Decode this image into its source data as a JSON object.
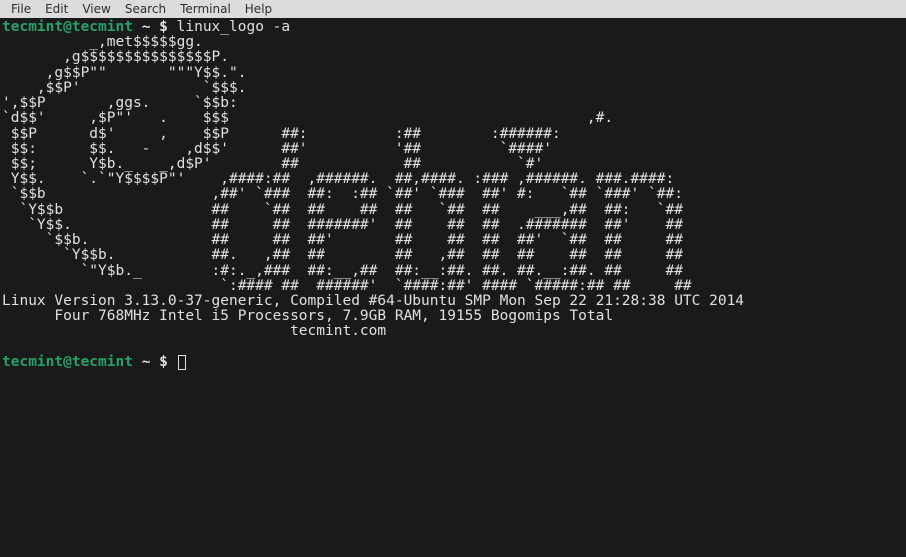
{
  "menubar": {
    "items": [
      "File",
      "Edit",
      "View",
      "Search",
      "Terminal",
      "Help"
    ]
  },
  "prompt1": {
    "user_host": "tecmint@tecmint",
    "sep": " ",
    "path": "~",
    "dollar": " $ ",
    "command": "linux_logo -a"
  },
  "ascii_art": "          _,met$$$$$gg.\n       ,g$$$$$$$$$$$$$$$P.\n     ,g$$P\"\"       \"\"\"Y$$.\".\n    ,$$P'              `$$$.\n',$$P       ,ggs.     `$$b:\n`d$$'     ,$P\"'   .    $$$                                         ,#.\n $$P      d$'     ,    $$P      ##:          :##        :######:\n $$:      $$.   -    ,d$$'      ##'          '##         `####'\n $$;      Y$b._   _,d$P'        ##            ##           `#'\n Y$$.    `.`\"Y$$$$P\"'    ,####:##  ,######.  ##,####. :### ,######. ###.####:\n `$$b                   ,##' `###  ##:  :## `##' `###  ##' #:   `## `###' `##:\n  `Y$$b                 ##    `##  ##    ##  ##   `##  ##    ___,##  ##:   `##\n   `Y$$.                ##     ##  #######'  ##    ##  ##  .#######  ##'    ##\n     `$$b.              ##     ##  ##'       ##    ##  ##  ##'  `##  ##     ##\n       `Y$$b.           ##.   ,##  ##        ##   ,##  ##  ##    ##  ##     ##\n         `\"Y$b._        :#:._,###  ##:__,##  ##:__:##. ##. ##.__:##. ##     ##\n                         `:#### ##  ######'  `####:##' #### `#####:## ##     ##\n",
  "sysinfo": {
    "line1": "Linux Version 3.13.0-37-generic, Compiled #64-Ubuntu SMP Mon Sep 22 21:28:38 UTC 2014",
    "line2": "      Four 768MHz Intel i5 Processors, 7.9GB RAM, 19155 Bogomips Total",
    "line3": "                                 tecmint.com"
  },
  "prompt2": {
    "user_host": "tecmint@tecmint",
    "sep": " ",
    "path": "~",
    "dollar": " $ "
  }
}
